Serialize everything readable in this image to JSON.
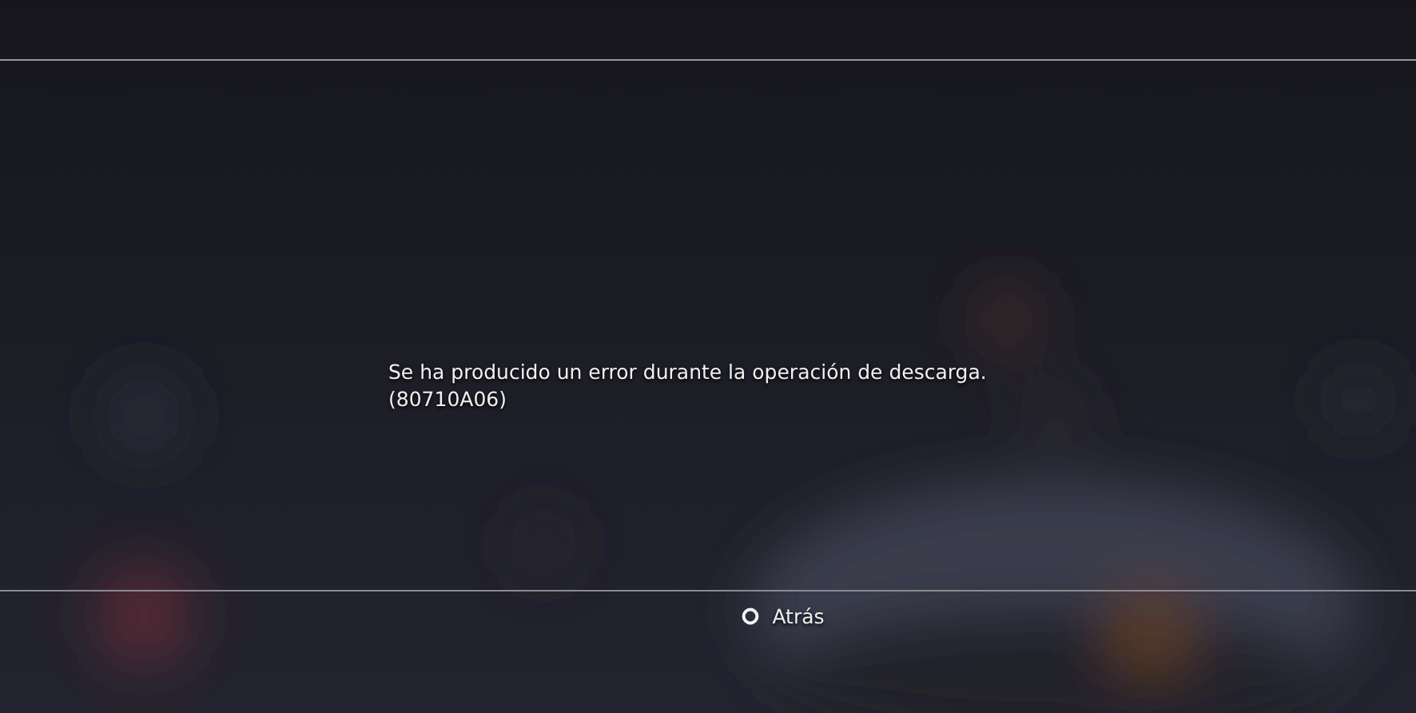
{
  "dialog": {
    "message_lines": [
      "Se ha producido un error durante la operación de descarga.",
      "(80710A06)"
    ]
  },
  "footer": {
    "buttons": [
      {
        "label": "Atrás"
      }
    ]
  }
}
